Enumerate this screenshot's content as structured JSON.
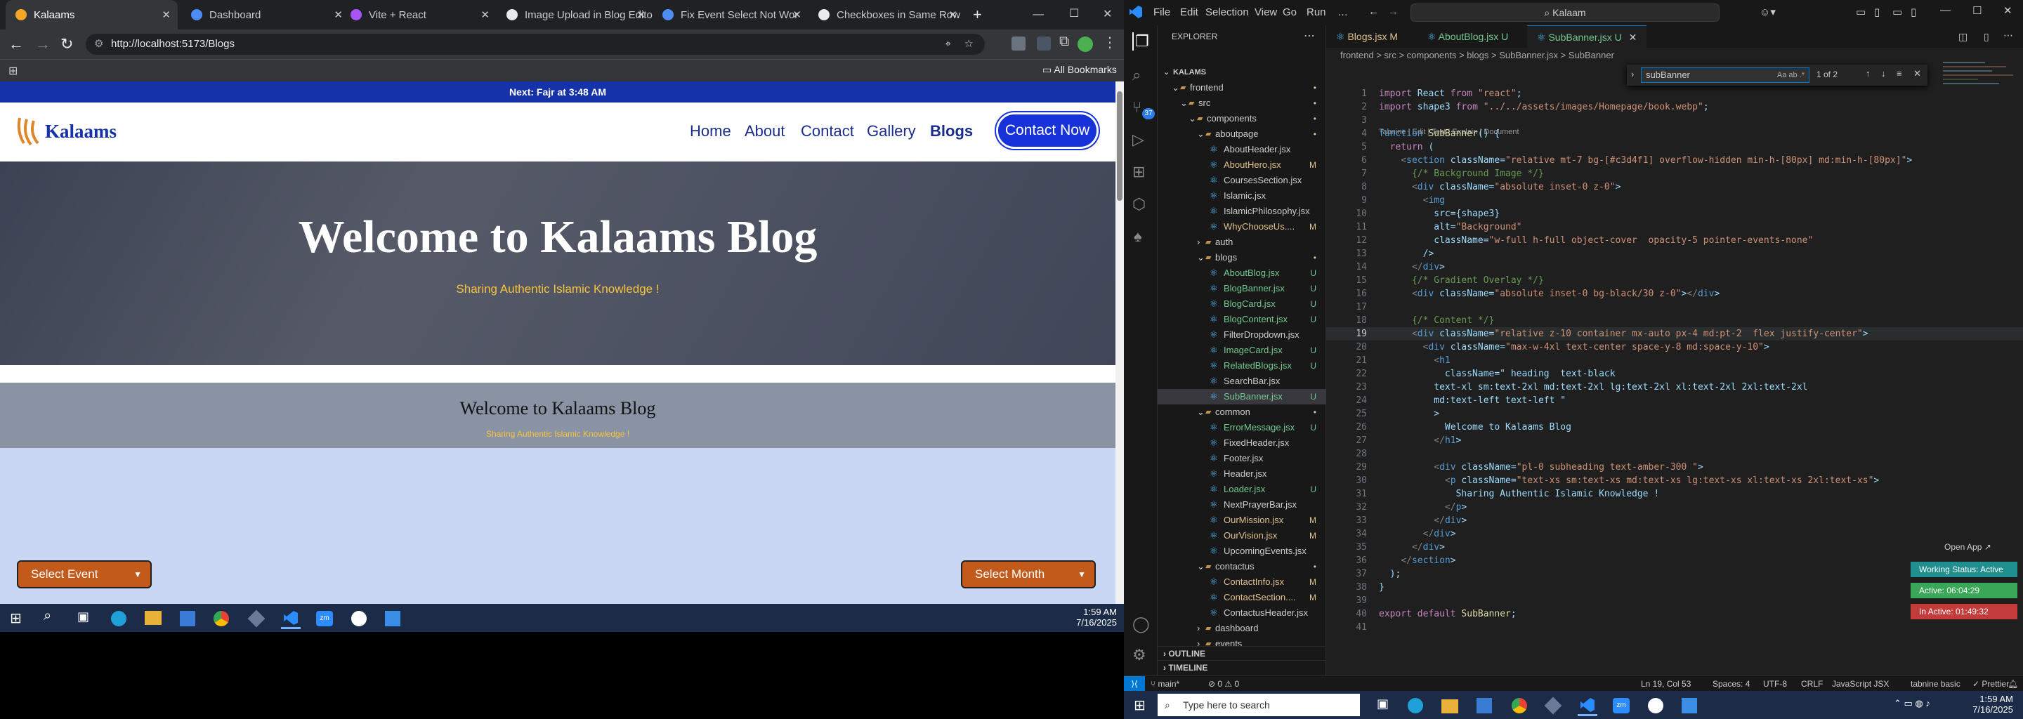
{
  "browser": {
    "tabs": [
      {
        "title": "Kalaams",
        "active": true
      },
      {
        "title": "Dashboard"
      },
      {
        "title": "Vite + React"
      },
      {
        "title": "Image Upload in Blog Editor"
      },
      {
        "title": "Fix Event Select Not Working"
      },
      {
        "title": "Checkboxes in Same Row"
      }
    ],
    "url": "http://localhost:5173/Blogs",
    "bookmarks_label": "All Bookmarks"
  },
  "site": {
    "prayer_bar": "Next: Fajr at 3:48 AM",
    "logo_text": "Kalaams",
    "nav": [
      "Home",
      "About",
      "Contact",
      "Gallery",
      "Blogs"
    ],
    "contact_button": "Contact Now",
    "hero_title": "Welcome to Kalaams Blog",
    "hero_subtitle": "Sharing Authentic Islamic Knowledge !",
    "hero2_title": "Welcome to Kalaams Blog",
    "hero2_subtitle": "Sharing Authentic Islamic Knowledge !",
    "select_event": "Select Event",
    "select_month": "Select Month"
  },
  "left_taskbar": {
    "time": "1:59 AM",
    "date": "7/16/2025"
  },
  "vscode": {
    "menu": [
      "File",
      "Edit",
      "Selection",
      "View",
      "Go",
      "Run",
      "…"
    ],
    "search": "Kalaam",
    "explorer_title": "EXPLORER",
    "tree": [
      {
        "label": "KALAMS",
        "depth": 0,
        "kind": "root"
      },
      {
        "label": "frontend",
        "depth": 1,
        "kind": "folder",
        "status": "•"
      },
      {
        "label": "src",
        "depth": 2,
        "kind": "folder",
        "status": "•"
      },
      {
        "label": "components",
        "depth": 3,
        "kind": "folder",
        "status": "•"
      },
      {
        "label": "aboutpage",
        "depth": 4,
        "kind": "folder",
        "status": "•"
      },
      {
        "label": "AboutHeader.jsx",
        "depth": 5,
        "kind": "file"
      },
      {
        "label": "AboutHero.jsx",
        "depth": 5,
        "kind": "file",
        "status": "M"
      },
      {
        "label": "CoursesSection.jsx",
        "depth": 5,
        "kind": "file"
      },
      {
        "label": "Islamic.jsx",
        "depth": 5,
        "kind": "file"
      },
      {
        "label": "IslamicPhilosophy.jsx",
        "depth": 5,
        "kind": "file"
      },
      {
        "label": "WhyChooseUs....",
        "depth": 5,
        "kind": "file",
        "status": "M"
      },
      {
        "label": "auth",
        "depth": 4,
        "kind": "folder",
        "collapsed": true
      },
      {
        "label": "blogs",
        "depth": 4,
        "kind": "folder",
        "status": "•"
      },
      {
        "label": "AboutBlog.jsx",
        "depth": 5,
        "kind": "file",
        "status": "U"
      },
      {
        "label": "BlogBanner.jsx",
        "depth": 5,
        "kind": "file",
        "status": "U"
      },
      {
        "label": "BlogCard.jsx",
        "depth": 5,
        "kind": "file",
        "status": "U"
      },
      {
        "label": "BlogContent.jsx",
        "depth": 5,
        "kind": "file",
        "status": "U"
      },
      {
        "label": "FilterDropdown.jsx",
        "depth": 5,
        "kind": "file"
      },
      {
        "label": "ImageCard.jsx",
        "depth": 5,
        "kind": "file",
        "status": "U"
      },
      {
        "label": "RelatedBlogs.jsx",
        "depth": 5,
        "kind": "file",
        "status": "U"
      },
      {
        "label": "SearchBar.jsx",
        "depth": 5,
        "kind": "file"
      },
      {
        "label": "SubBanner.jsx",
        "depth": 5,
        "kind": "file",
        "status": "U",
        "selected": true
      },
      {
        "label": "common",
        "depth": 4,
        "kind": "folder",
        "status": "•"
      },
      {
        "label": "ErrorMessage.jsx",
        "depth": 5,
        "kind": "file",
        "status": "U"
      },
      {
        "label": "FixedHeader.jsx",
        "depth": 5,
        "kind": "file"
      },
      {
        "label": "Footer.jsx",
        "depth": 5,
        "kind": "file"
      },
      {
        "label": "Header.jsx",
        "depth": 5,
        "kind": "file"
      },
      {
        "label": "Loader.jsx",
        "depth": 5,
        "kind": "file",
        "status": "U"
      },
      {
        "label": "NextPrayerBar.jsx",
        "depth": 5,
        "kind": "file"
      },
      {
        "label": "OurMission.jsx",
        "depth": 5,
        "kind": "file",
        "status": "M"
      },
      {
        "label": "OurVision.jsx",
        "depth": 5,
        "kind": "file",
        "status": "M"
      },
      {
        "label": "UpcomingEvents.jsx",
        "depth": 5,
        "kind": "file"
      },
      {
        "label": "contactus",
        "depth": 4,
        "kind": "folder",
        "status": "•"
      },
      {
        "label": "ContactInfo.jsx",
        "depth": 5,
        "kind": "file",
        "status": "M"
      },
      {
        "label": "ContactSection....",
        "depth": 5,
        "kind": "file",
        "status": "M"
      },
      {
        "label": "ContactusHeader.jsx",
        "depth": 5,
        "kind": "file"
      },
      {
        "label": "dashboard",
        "depth": 4,
        "kind": "folder",
        "collapsed": true
      },
      {
        "label": "events",
        "depth": 4,
        "kind": "folder",
        "collapsed": true
      }
    ],
    "outline_label": "OUTLINE",
    "timeline_label": "TIMELINE",
    "editor_tabs": [
      {
        "label": "Blogs.jsx",
        "status": "M"
      },
      {
        "label": "AboutBlog.jsx",
        "status": "U"
      },
      {
        "label": "SubBanner.jsx",
        "status": "U",
        "active": true
      }
    ],
    "breadcrumb": "frontend > src > components > blogs > SubBanner.jsx > SubBanner",
    "find": {
      "query": "subBanner",
      "result": "1 of 2"
    },
    "codelens": "Tabnine | Edit | Test | Explain | Document",
    "code_lines": [
      "import React from \"react\";",
      "import shape3 from \"../../assets/images/Homepage/book.webp\";",
      "",
      "function SubBanner() {",
      "  return (",
      "    <section className=\"relative mt-7 bg-[#c3d4f1] overflow-hidden min-h-[80px] md:min-h-[80px]\">",
      "      {/* Background Image */}",
      "      <div className=\"absolute inset-0 z-0\">",
      "        <img",
      "          src={shape3}",
      "          alt=\"Background\"",
      "          className=\"w-full h-full object-cover  opacity-5 pointer-events-none\"",
      "        />",
      "      </div>",
      "      {/* Gradient Overlay */}",
      "      <div className=\"absolute inset-0 bg-black/30 z-0\"></div>",
      "",
      "      {/* Content */}",
      "      <div className=\"relative z-10 container mx-auto px-4 md:pt-2  flex justify-center\">",
      "        <div className=\"max-w-4xl text-center space-y-8 md:space-y-10\">",
      "          <h1",
      "            className=\" heading  text-black",
      "          text-xl sm:text-2xl md:text-2xl lg:text-2xl xl:text-2xl 2xl:text-2xl",
      "          md:text-left text-left \"",
      "          >",
      "            Welcome to Kalaams Blog",
      "          </h1>",
      "",
      "          <div className=\"pl-0 subheading text-amber-300 \">",
      "            <p className=\"text-xs sm:text-xs md:text-xs lg:text-xs xl:text-xs 2xl:text-xs\">",
      "              Sharing Authentic Islamic Knowledge !",
      "            </p>",
      "          </div>",
      "        </div>",
      "      </div>",
      "    </section>",
      "  );",
      "}",
      "",
      "export default SubBanner;",
      ""
    ],
    "open_app": "Open App ↗",
    "working_status": "Working Status: Active",
    "active_time": "Active: 06:04:29",
    "inactive_time": "In Active: 01:49:32",
    "status": {
      "branch": "main*",
      "errors": "⊘ 0 ⚠ 0",
      "position": "Ln 19, Col 53",
      "spaces": "Spaces: 4",
      "encoding": "UTF-8",
      "eol": "CRLF",
      "language": "JavaScript JSX",
      "tabnine": "tabnine basic",
      "prettier": "✓ Prettier"
    }
  },
  "taskbar": {
    "search_placeholder": "Type here to search",
    "time": "1:59 AM",
    "date": "7/16/2025"
  },
  "colors": {
    "accent": "#1632a8",
    "vscode_bg": "#1e1e1e",
    "badge_green": "#3aa657",
    "badge_red": "#c43b3b"
  }
}
